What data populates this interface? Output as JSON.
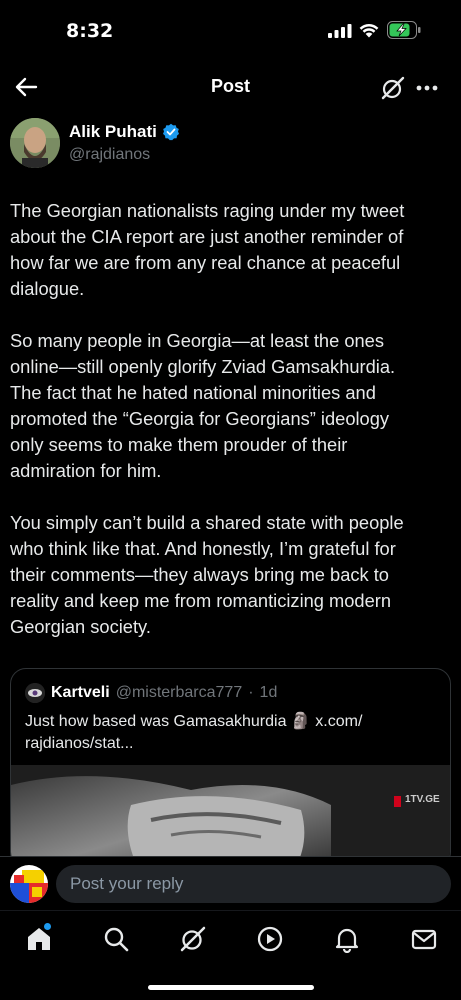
{
  "status_bar": {
    "time": "8:32"
  },
  "header": {
    "title": "Post"
  },
  "author": {
    "name": "Alik Puhati",
    "handle": "@rajdianos",
    "verified": true
  },
  "post": {
    "paragraphs": [
      "The Georgian nationalists raging under my tweet\nabout the CIA report are just another reminder of\nhow far we are from any real chance at peaceful\ndialogue.",
      "So many people in Georgia—at least the ones\nonline—still openly glorify Zviad Gamsakhurdia.\nThe fact that he hated national minorities and\npromoted the “Georgia for Georgians” ideology\nonly seems to make them prouder of their\nadmiration for him.",
      "You simply can’t build a shared state with people\nwho think like that. And honestly, I’m grateful for\ntheir comments—they always bring me back to\nreality and keep me from romanticizing modern\nGeorgian society."
    ]
  },
  "quoted_post": {
    "name": "Kartveli",
    "handle": "@misterbarca777",
    "separator": "·",
    "time": "1d",
    "text_line1": "Just how based was Gamasakhurdia 🗿 x.com/",
    "text_line2": "rajdianos/stat...",
    "media_watermark": "1TV.GE"
  },
  "reply": {
    "placeholder": "Post your reply"
  },
  "tabs": [
    "home-icon",
    "search-icon",
    "grok-icon",
    "video-icon",
    "notifications-icon",
    "messages-icon"
  ],
  "colors": {
    "background": "#000000",
    "text": "#e7e9ea",
    "secondary_text": "#71767b",
    "accent": "#1d9bf0",
    "battery": "#34c759"
  }
}
